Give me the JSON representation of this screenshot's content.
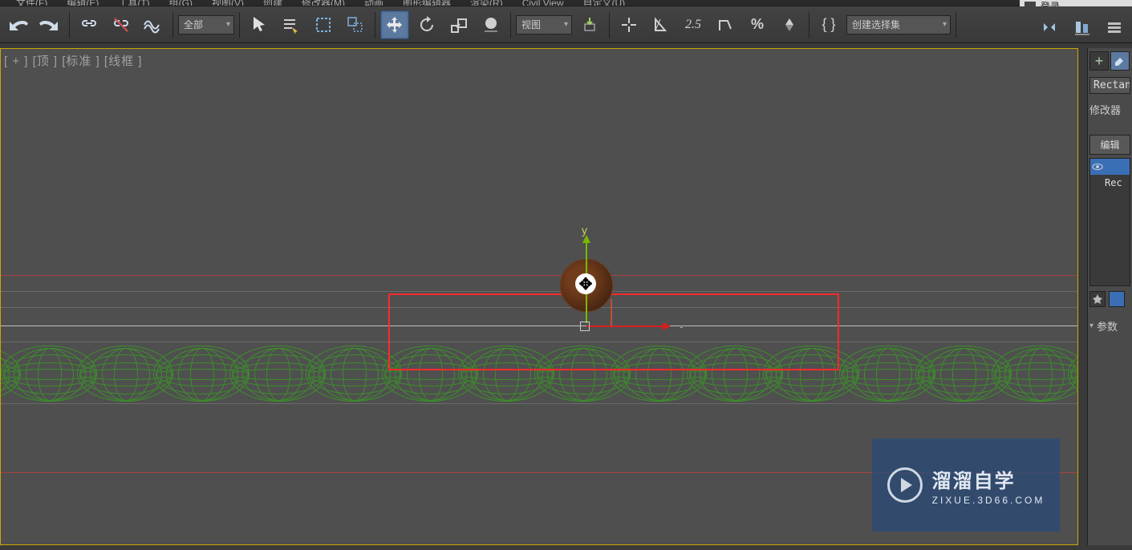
{
  "menu": {
    "items": [
      "文件(F)",
      "编辑(E)",
      "工具(T)",
      "组(G)",
      "视图(V)",
      "创建",
      "修改器(M)",
      "动画",
      "图形编辑器",
      "渲染(R)",
      "Civil View",
      "自定义(U)"
    ]
  },
  "login": {
    "label": "登录"
  },
  "toolbar": {
    "select_all": "全部",
    "select_view": "视图",
    "select_set": "创建选择集",
    "percent_label": "2.5"
  },
  "viewport": {
    "label": "[ + ] [顶 ] [标准 ] [线框 ]",
    "axis_y": "y"
  },
  "panel": {
    "object_type": "Rectan",
    "modifier_title": "修改器",
    "edit_button": "编辑",
    "list_item": "Rec",
    "rollup": "参数"
  },
  "watermark": {
    "title": "溜溜自学",
    "subtitle": "ZIXUE.3D66.COM"
  }
}
